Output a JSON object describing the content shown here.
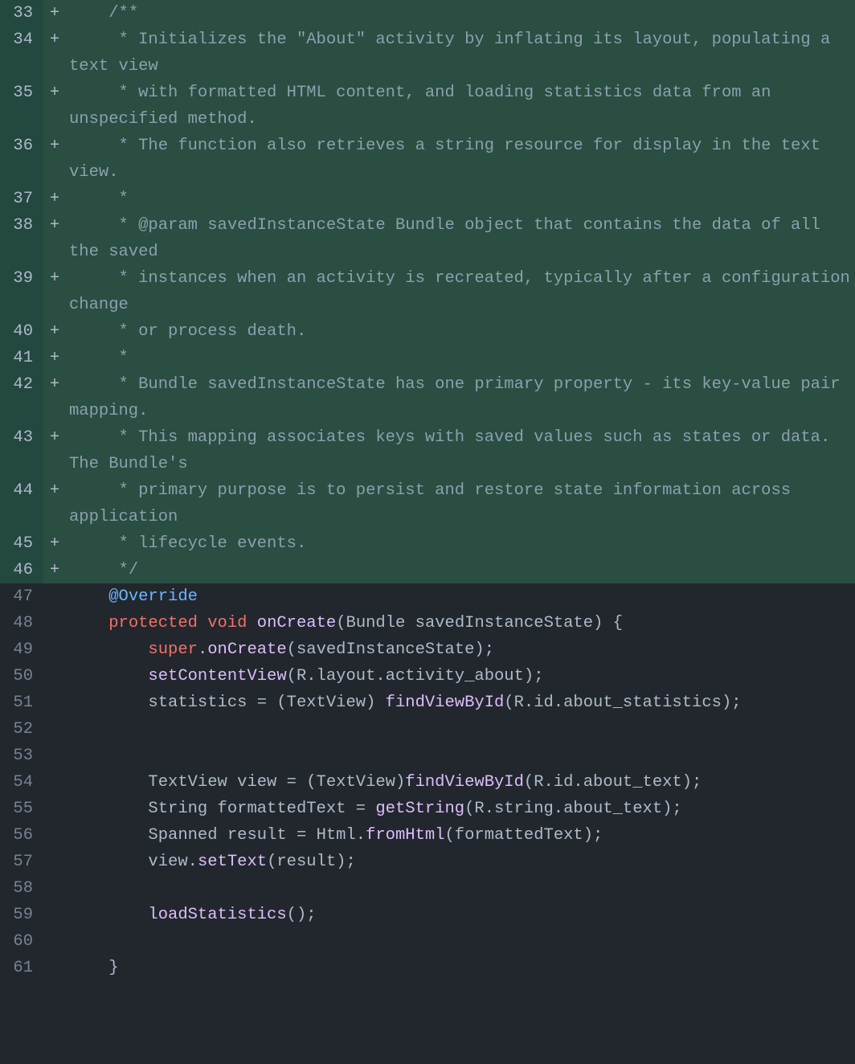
{
  "lines": [
    {
      "num": "33",
      "type": "added",
      "sign": "+",
      "seg": [
        {
          "c": "tk-comment",
          "t": "    /**"
        }
      ]
    },
    {
      "num": "34",
      "type": "added",
      "sign": "+",
      "seg": [
        {
          "c": "tk-comment",
          "t": "     * Initializes the \"About\" activity by inflating its layout, populating a text view"
        }
      ]
    },
    {
      "num": "35",
      "type": "added",
      "sign": "+",
      "seg": [
        {
          "c": "tk-comment",
          "t": "     * with formatted HTML content, and loading statistics data from an unspecified method."
        }
      ]
    },
    {
      "num": "36",
      "type": "added",
      "sign": "+",
      "seg": [
        {
          "c": "tk-comment",
          "t": "     * The function also retrieves a string resource for display in the text view."
        }
      ]
    },
    {
      "num": "37",
      "type": "added",
      "sign": "+",
      "seg": [
        {
          "c": "tk-comment",
          "t": "     *"
        }
      ]
    },
    {
      "num": "38",
      "type": "added",
      "sign": "+",
      "seg": [
        {
          "c": "tk-comment",
          "t": "     * @param savedInstanceState Bundle object that contains the data of all the saved"
        }
      ]
    },
    {
      "num": "39",
      "type": "added",
      "sign": "+",
      "seg": [
        {
          "c": "tk-comment",
          "t": "     * instances when an activity is recreated, typically after a configuration change"
        }
      ]
    },
    {
      "num": "40",
      "type": "added",
      "sign": "+",
      "seg": [
        {
          "c": "tk-comment",
          "t": "     * or process death."
        }
      ]
    },
    {
      "num": "41",
      "type": "added",
      "sign": "+",
      "seg": [
        {
          "c": "tk-comment",
          "t": "     *"
        }
      ]
    },
    {
      "num": "42",
      "type": "added",
      "sign": "+",
      "seg": [
        {
          "c": "tk-comment",
          "t": "     * Bundle savedInstanceState has one primary property - its key-value pair mapping."
        }
      ]
    },
    {
      "num": "43",
      "type": "added",
      "sign": "+",
      "seg": [
        {
          "c": "tk-comment",
          "t": "     * This mapping associates keys with saved values such as states or data. The Bundle's"
        }
      ]
    },
    {
      "num": "44",
      "type": "added",
      "sign": "+",
      "seg": [
        {
          "c": "tk-comment",
          "t": "     * primary purpose is to persist and restore state information across application"
        }
      ]
    },
    {
      "num": "45",
      "type": "added",
      "sign": "+",
      "seg": [
        {
          "c": "tk-comment",
          "t": "     * lifecycle events."
        }
      ]
    },
    {
      "num": "46",
      "type": "added",
      "sign": "+",
      "seg": [
        {
          "c": "tk-comment",
          "t": "     */"
        }
      ]
    },
    {
      "num": "47",
      "type": "ctx",
      "sign": " ",
      "seg": [
        {
          "c": "",
          "t": "    "
        },
        {
          "c": "tk-ann",
          "t": "@Override"
        }
      ]
    },
    {
      "num": "48",
      "type": "ctx",
      "sign": " ",
      "seg": [
        {
          "c": "",
          "t": "    "
        },
        {
          "c": "tk-kw",
          "t": "protected"
        },
        {
          "c": "",
          "t": " "
        },
        {
          "c": "tk-kw",
          "t": "void"
        },
        {
          "c": "",
          "t": " "
        },
        {
          "c": "tk-fn",
          "t": "onCreate"
        },
        {
          "c": "",
          "t": "("
        },
        {
          "c": "tk-type",
          "t": "Bundle"
        },
        {
          "c": "",
          "t": " "
        },
        {
          "c": "tk-id",
          "t": "savedInstanceState"
        },
        {
          "c": "",
          "t": ") {"
        }
      ]
    },
    {
      "num": "49",
      "type": "ctx",
      "sign": " ",
      "seg": [
        {
          "c": "",
          "t": "        "
        },
        {
          "c": "tk-kw",
          "t": "super"
        },
        {
          "c": "",
          "t": "."
        },
        {
          "c": "tk-fn",
          "t": "onCreate"
        },
        {
          "c": "",
          "t": "(savedInstanceState);"
        }
      ]
    },
    {
      "num": "50",
      "type": "ctx",
      "sign": " ",
      "seg": [
        {
          "c": "",
          "t": "        "
        },
        {
          "c": "tk-fn",
          "t": "setContentView"
        },
        {
          "c": "",
          "t": "(R.layout.activity_about);"
        }
      ]
    },
    {
      "num": "51",
      "type": "ctx",
      "sign": " ",
      "seg": [
        {
          "c": "",
          "t": "        statistics = (TextView) "
        },
        {
          "c": "tk-fn",
          "t": "findViewById"
        },
        {
          "c": "",
          "t": "(R.id.about_statistics);"
        }
      ]
    },
    {
      "num": "52",
      "type": "ctx",
      "sign": " ",
      "seg": [
        {
          "c": "",
          "t": ""
        }
      ]
    },
    {
      "num": "53",
      "type": "ctx",
      "sign": " ",
      "seg": [
        {
          "c": "",
          "t": ""
        }
      ]
    },
    {
      "num": "54",
      "type": "ctx",
      "sign": " ",
      "seg": [
        {
          "c": "",
          "t": "        "
        },
        {
          "c": "tk-type",
          "t": "TextView"
        },
        {
          "c": "",
          "t": " view = (TextView)"
        },
        {
          "c": "tk-fn",
          "t": "findViewById"
        },
        {
          "c": "",
          "t": "(R.id.about_text);"
        }
      ]
    },
    {
      "num": "55",
      "type": "ctx",
      "sign": " ",
      "seg": [
        {
          "c": "",
          "t": "        "
        },
        {
          "c": "tk-type",
          "t": "String"
        },
        {
          "c": "",
          "t": " formattedText = "
        },
        {
          "c": "tk-fn",
          "t": "getString"
        },
        {
          "c": "",
          "t": "(R.string.about_text);"
        }
      ]
    },
    {
      "num": "56",
      "type": "ctx",
      "sign": " ",
      "seg": [
        {
          "c": "",
          "t": "        "
        },
        {
          "c": "tk-type",
          "t": "Spanned"
        },
        {
          "c": "",
          "t": " result = Html."
        },
        {
          "c": "tk-fn",
          "t": "fromHtml"
        },
        {
          "c": "",
          "t": "(formattedText);"
        }
      ]
    },
    {
      "num": "57",
      "type": "ctx",
      "sign": " ",
      "seg": [
        {
          "c": "",
          "t": "        view."
        },
        {
          "c": "tk-fn",
          "t": "setText"
        },
        {
          "c": "",
          "t": "(result);"
        }
      ]
    },
    {
      "num": "58",
      "type": "ctx",
      "sign": " ",
      "seg": [
        {
          "c": "",
          "t": ""
        }
      ]
    },
    {
      "num": "59",
      "type": "ctx",
      "sign": " ",
      "seg": [
        {
          "c": "",
          "t": "        "
        },
        {
          "c": "tk-fn",
          "t": "loadStatistics"
        },
        {
          "c": "",
          "t": "();"
        }
      ]
    },
    {
      "num": "60",
      "type": "ctx",
      "sign": " ",
      "seg": [
        {
          "c": "",
          "t": ""
        }
      ]
    },
    {
      "num": "61",
      "type": "ctx",
      "sign": " ",
      "seg": [
        {
          "c": "",
          "t": "    }"
        }
      ]
    }
  ]
}
